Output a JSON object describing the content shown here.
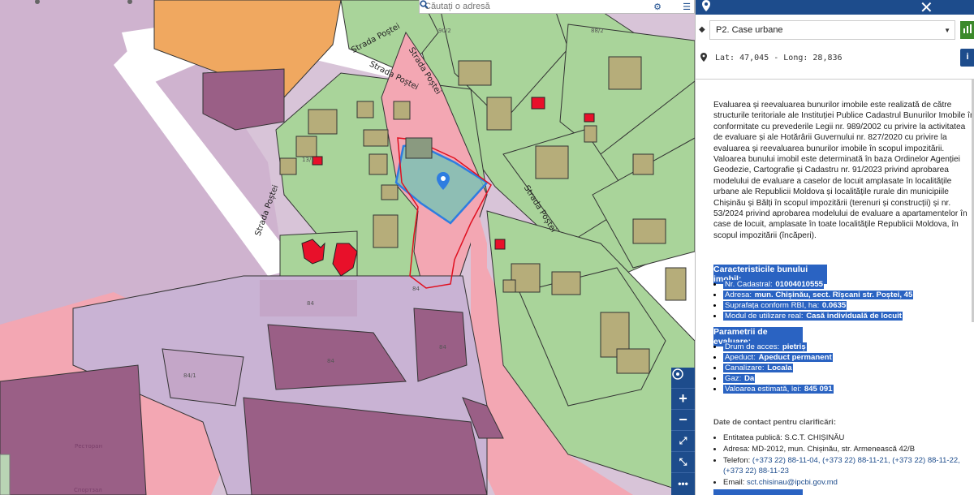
{
  "search": {
    "placeholder": "Căutați o adresă"
  },
  "map": {
    "streets": [
      "Strada Poștei",
      "Strada Poștei",
      "Strada Poștei",
      "Strada Poștei"
    ],
    "plot_numbers": [
      "90/2",
      "88/2",
      "84",
      "84",
      "84",
      "84",
      "84/1",
      "13/1"
    ],
    "poi_labels": [
      "Ресторан",
      "Спортзал"
    ],
    "controls": [
      "locate",
      "zoom-in",
      "zoom-out",
      "fit",
      "fullscreen",
      "more"
    ]
  },
  "panel": {
    "layer_value": "P2. Case urbane",
    "coords": "Lat: 47,045 - Long: 28,836",
    "intro": "Evaluarea și reevaluarea bunurilor imobile este realizată de către structurile teritoriale ale Instituției Publice Cadastrul Bunurilor Imobile în conformitate cu prevederile Legii nr. 989/2002 cu privire la activitatea de evaluare și ale Hotărârii Guvernului nr. 827/2020 cu privire la evaluarea și reevaluarea bunurilor imobile în scopul impozitării. Valoarea bunului imobil este determinată în baza Ordinelor Agenției Geodezie, Cartografie și Cadastru nr. 91/2023 privind aprobarea modelului de evaluare a caselor de locuit amplasate în localitățile urbane ale Republicii Moldova și localitățile rurale din municipiile Chișinău și Bălți în scopul impozitării (terenuri și construcții) și nr. 53/2024 privind aprobarea modelului de evaluare a apartamentelor în case de locuit, amplasate în toate localitățile Republicii Moldova, în scopul impozitării (încăperi).",
    "characteristics": {
      "title": "Caracteristicile bunului imobil:",
      "items": [
        {
          "label": "Nr. Cadastral: ",
          "value": "01004010555"
        },
        {
          "label": "Adresa: ",
          "value": "mun. Chișinău, sect. Rîșcani str. Poștei, 45"
        },
        {
          "label": "Suprafața conform RBI, ha: ",
          "value": "0.0635"
        },
        {
          "label": "Modul de utilizare real: ",
          "value": "Casă individuală de locuit"
        }
      ]
    },
    "parameters": {
      "title": "Parametrii de evaluare:",
      "items": [
        {
          "label": "Drum de acces: ",
          "value": "pietriș"
        },
        {
          "label": "Apeduct: ",
          "value": "Apeduct permanent"
        },
        {
          "label": "Canalizare: ",
          "value": "Locala"
        },
        {
          "label": "Gaz: ",
          "value": "Da"
        },
        {
          "label": "Valoarea estimată, lei: ",
          "value": "845 091"
        }
      ]
    },
    "contact": {
      "title": "Date de contact pentru clarificări:",
      "entity": "Entitatea publică: S.C.T. CHIȘINĂU",
      "address": "Adresa: MD-2012, mun. Chișinău, str. Armenească 42/B",
      "phone_label": "Telefon: ",
      "phones": "(+373 22) 88-11-04, (+373 22) 88-11-21, (+373 22) 88-11-22, (+373 22) 88-11-23",
      "email_label": "Email: ",
      "email": "sct.chisinau@ipcbi.gov.md"
    }
  },
  "colors": {
    "accent": "#1d4c8c",
    "parcel_green": "#a9d49a",
    "zone_pink": "#f3a7b3",
    "zone_purple": "#c9b3d4",
    "building": "#b6ad7a",
    "highlight": "#2a63c2"
  }
}
